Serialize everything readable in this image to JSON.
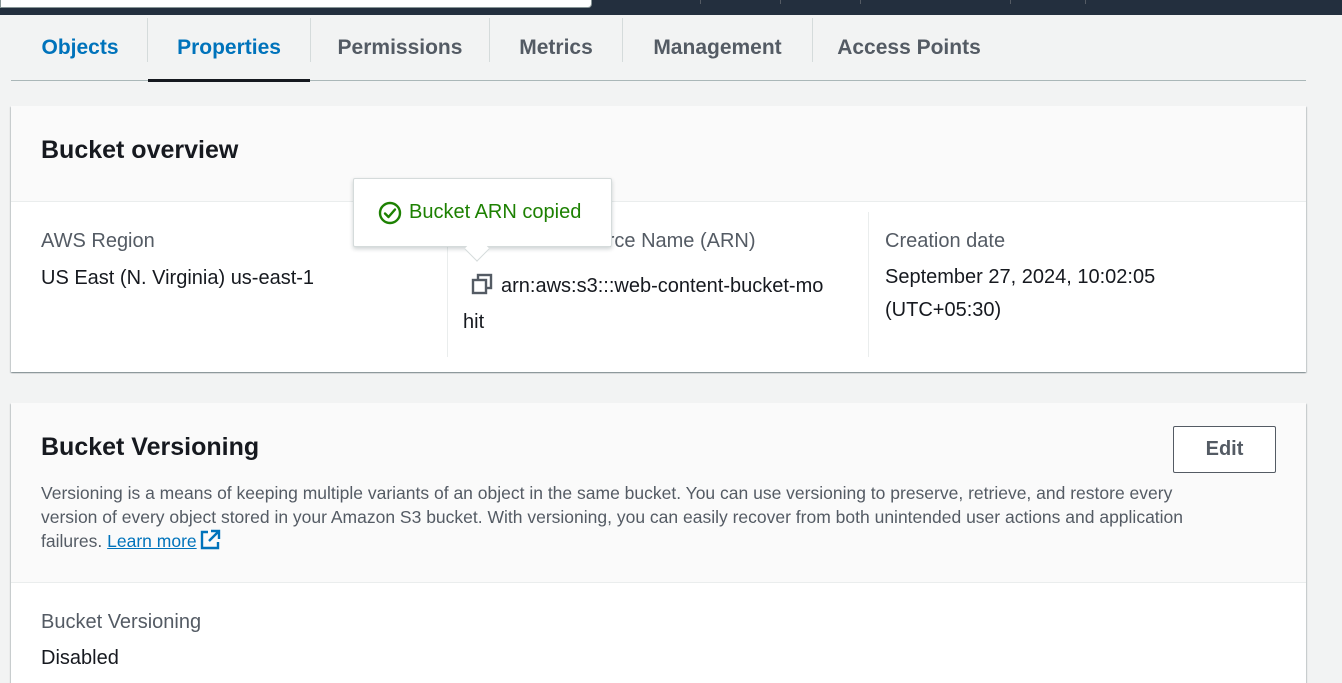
{
  "tabs": [
    {
      "label": "Objects"
    },
    {
      "label": "Properties"
    },
    {
      "label": "Permissions"
    },
    {
      "label": "Metrics"
    },
    {
      "label": "Management"
    },
    {
      "label": "Access Points"
    }
  ],
  "overview": {
    "title": "Bucket overview",
    "region_label": "AWS Region",
    "region_value": "US East (N. Virginia) us-east-1",
    "arn_label": "Amazon Resource Name (ARN)",
    "arn_value_line1": "arn:aws:s3:::web-content-bucket-mo",
    "arn_value_line2": "hit",
    "created_label": "Creation date",
    "created_value_line1": "September 27, 2024, 10:02:05",
    "created_value_line2": "(UTC+05:30)"
  },
  "popover": {
    "message": "Bucket ARN copied",
    "icon": "check-circle-icon"
  },
  "versioning": {
    "title": "Bucket Versioning",
    "edit_label": "Edit",
    "description_line1": "Versioning is a means of keeping multiple variants of an object in the same bucket. You can use versioning to preserve, retrieve, and restore every",
    "description_line2": "version of every object stored in your Amazon S3 bucket. With versioning, you can easily recover from both unintended user actions and application",
    "description_line3": "failures.",
    "learn_more": "Learn more",
    "field_label": "Bucket Versioning",
    "field_value": "Disabled"
  },
  "colors": {
    "link": "#0073bb",
    "success": "#1d8102",
    "topbar": "#232f3e"
  }
}
